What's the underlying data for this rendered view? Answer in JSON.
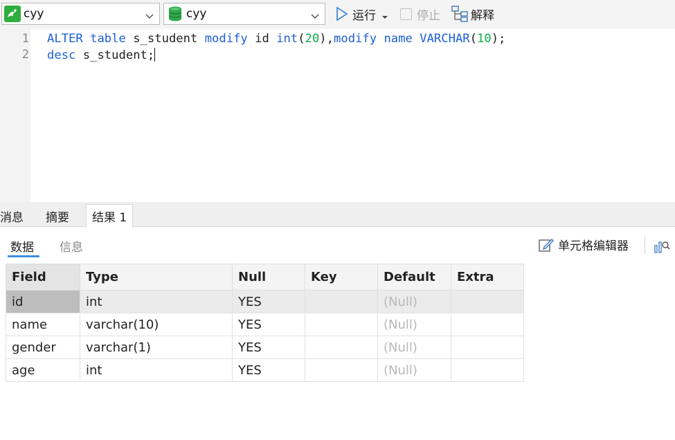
{
  "toolbar": {
    "connection": "cyy",
    "database": "cyy",
    "run_label": "运行",
    "stop_label": "停止",
    "explain_label": "解释"
  },
  "editor": {
    "line_numbers": [
      "1",
      "2"
    ],
    "line1": {
      "t1": "ALTER",
      "t2": " ",
      "t3": "table",
      "t4": " s_student ",
      "t5": "modify",
      "t6": " id ",
      "t7": "int",
      "t8": "(",
      "t9": "20",
      "t10": "),",
      "t11": "modify",
      "t12": " ",
      "t13": "name",
      "t14": " ",
      "t15": "VARCHAR",
      "t16": "(",
      "t17": "10",
      "t18": ");"
    },
    "line2": {
      "t1": "desc",
      "t2": " s_student;"
    }
  },
  "result_tabs": [
    "消息",
    "摘要",
    "结果 1"
  ],
  "sub_tabs": [
    "数据",
    "信息"
  ],
  "cell_editor_label": "单元格编辑器",
  "grid": {
    "headers": [
      "Field",
      "Type",
      "Null",
      "Key",
      "Default",
      "Extra"
    ],
    "rows": [
      [
        "id",
        "int",
        "YES",
        "",
        "(Null)",
        ""
      ],
      [
        "name",
        "varchar(10)",
        "YES",
        "",
        "(Null)",
        ""
      ],
      [
        "gender",
        "varchar(1)",
        "YES",
        "",
        "(Null)",
        ""
      ],
      [
        "age",
        "int",
        "YES",
        "",
        "(Null)",
        ""
      ]
    ]
  },
  "colors": {
    "keyword": "#1d5fd6",
    "number": "#10a84a",
    "run_icon": "#2f7fd4",
    "db_icon": "#2fa64a",
    "active_underline": "#3d8fe0"
  },
  "icons": [
    "mysql-connection-icon",
    "database-icon",
    "play-icon",
    "stop-icon",
    "explain-icon",
    "pencil-icon",
    "chart-icon"
  ]
}
